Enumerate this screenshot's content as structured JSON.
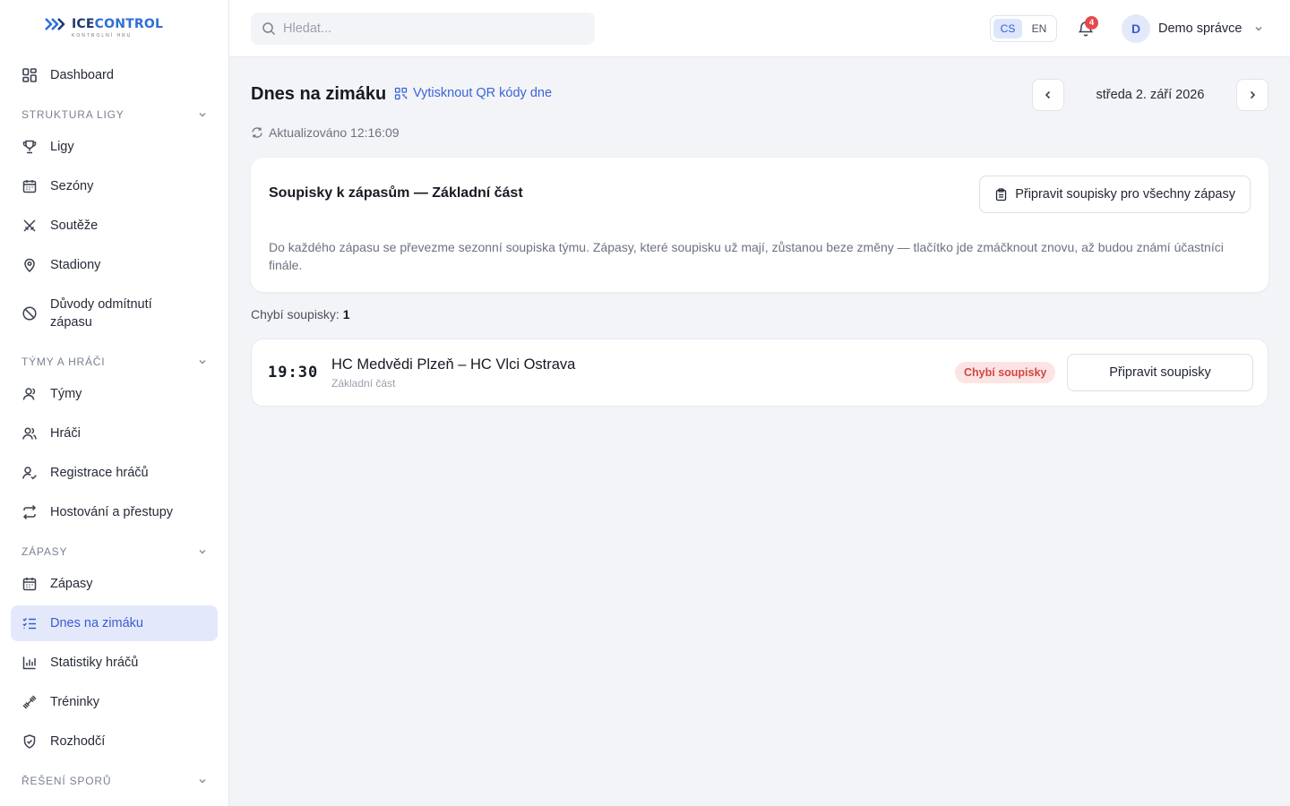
{
  "brand": {
    "name_a": "ICE",
    "name_b": "CONTROL",
    "tagline": "KONTROLNÍ HRU"
  },
  "sidebar": {
    "dashboard": "Dashboard",
    "sections": [
      {
        "title": "STRUKTURA LIGY",
        "items": [
          "Ligy",
          "Sezóny",
          "Soutěže",
          "Stadiony",
          "Důvody odmítnutí zápasu"
        ]
      },
      {
        "title": "TÝMY A HRÁČI",
        "items": [
          "Týmy",
          "Hráči",
          "Registrace hráčů",
          "Hostování a přestupy"
        ]
      },
      {
        "title": "ZÁPASY",
        "items": [
          "Zápasy",
          "Dnes na zimáku",
          "Statistiky hráčů",
          "Tréninky",
          "Rozhodčí"
        ]
      },
      {
        "title": "ŘEŠENÍ SPORŮ",
        "items": []
      }
    ],
    "active_item": "Dnes na zimáku",
    "accent": "#3a5bd0"
  },
  "header": {
    "search_placeholder": "Hledat...",
    "languages": [
      "CS",
      "EN"
    ],
    "active_language": "CS",
    "notifications": "4",
    "user_initial": "D",
    "user_name": "Demo správce"
  },
  "main": {
    "title": "Dnes na zimáku",
    "qr_link": "Vytisknout QR kódy dne",
    "date": "středa 2. září 2026",
    "updated": "Aktualizováno 12:16:09",
    "card": {
      "title": "Soupisky k zápasům — Základní část",
      "button": "Připravit soupisky pro všechny zápasy",
      "description": "Do každého zápasu se převezme sezonní soupiska týmu. Zápasy, které soupisku už mají, zůstanou beze změny — tlačítko jde zmáčknout znovu, až budou známí účastníci finále."
    },
    "missing_label": "Chybí soupisky:",
    "missing_count": "1",
    "matches": [
      {
        "time": "19:30",
        "teams": "HC Medvědi Plzeň – HC Vlci Ostrava",
        "part": "Základní část",
        "badge": "Chybí soupisky",
        "button": "Připravit soupisky"
      }
    ]
  }
}
